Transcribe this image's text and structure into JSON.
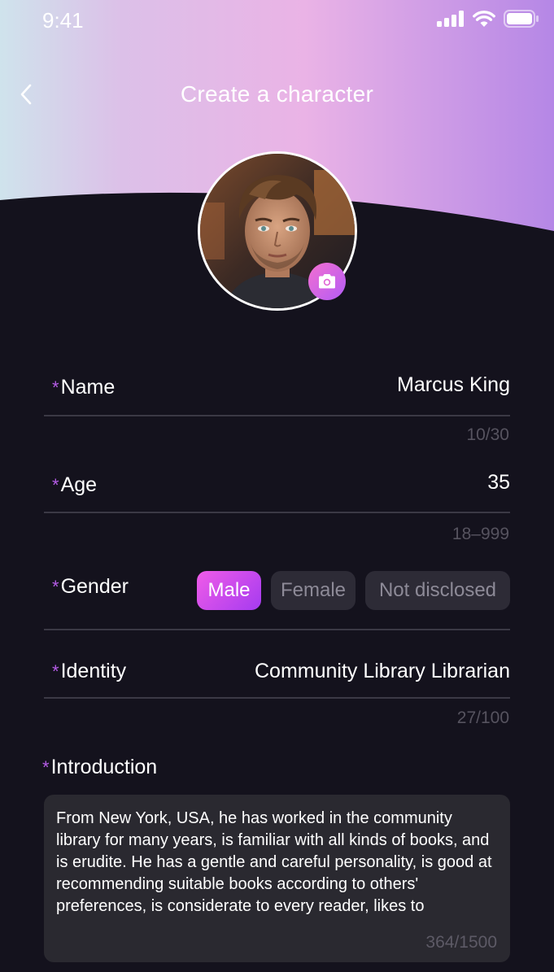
{
  "status_bar": {
    "time": "9:41",
    "icons": [
      "signal-icon",
      "wifi-icon",
      "battery-icon"
    ]
  },
  "header": {
    "title": "Create a character",
    "back_icon": "chevron-left-icon"
  },
  "avatar": {
    "camera_icon": "camera-icon"
  },
  "form": {
    "name": {
      "label": "Name",
      "value": "Marcus King",
      "counter": "10/30"
    },
    "age": {
      "label": "Age",
      "value": "35",
      "hint": "18–999"
    },
    "gender": {
      "label": "Gender",
      "options": [
        "Male",
        "Female",
        "Not disclosed"
      ],
      "selected": "Male"
    },
    "identity": {
      "label": "Identity",
      "value": "Community Library Librarian",
      "counter": "27/100"
    },
    "introduction": {
      "label": "Introduction",
      "value": "From New York, USA, he has worked in the community library for many years, is familiar with all kinds of books, and is erudite. He has a gentle and careful personality, is good at recommending suitable books according to others' preferences, is considerate to every reader, likes to",
      "counter": "364/1500"
    },
    "required_marker": "*"
  },
  "colors": {
    "background": "#14121d",
    "accent_start": "#f05ce8",
    "accent_end": "#a53bf0",
    "required_star": "#b55ce6",
    "muted_text": "#56535f"
  }
}
